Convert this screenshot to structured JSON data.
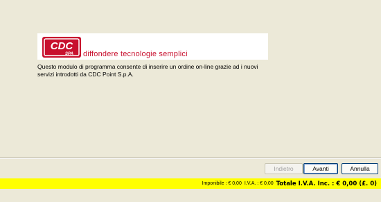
{
  "banner": {
    "logo_text": "CDC",
    "logo_sub": "SPA",
    "tagline": "diffondere tecnologie semplici",
    "brand_color": "#c8102e"
  },
  "description": "Questo modulo di programma consente di inserire un ordine on-line grazie ad i nuovi servizi introdotti da CDC Point S.p.A.",
  "buttons": {
    "back": "Indietro",
    "next": "Avanti",
    "cancel": "Annulla"
  },
  "totals": {
    "imponibile": "Imponibile : € 0,00",
    "iva": "I.V.A. : € 0,00",
    "totale": "Totale I.V.A. Inc. : € 0,00 (£. 0)",
    "bar_color": "#ffff00"
  }
}
